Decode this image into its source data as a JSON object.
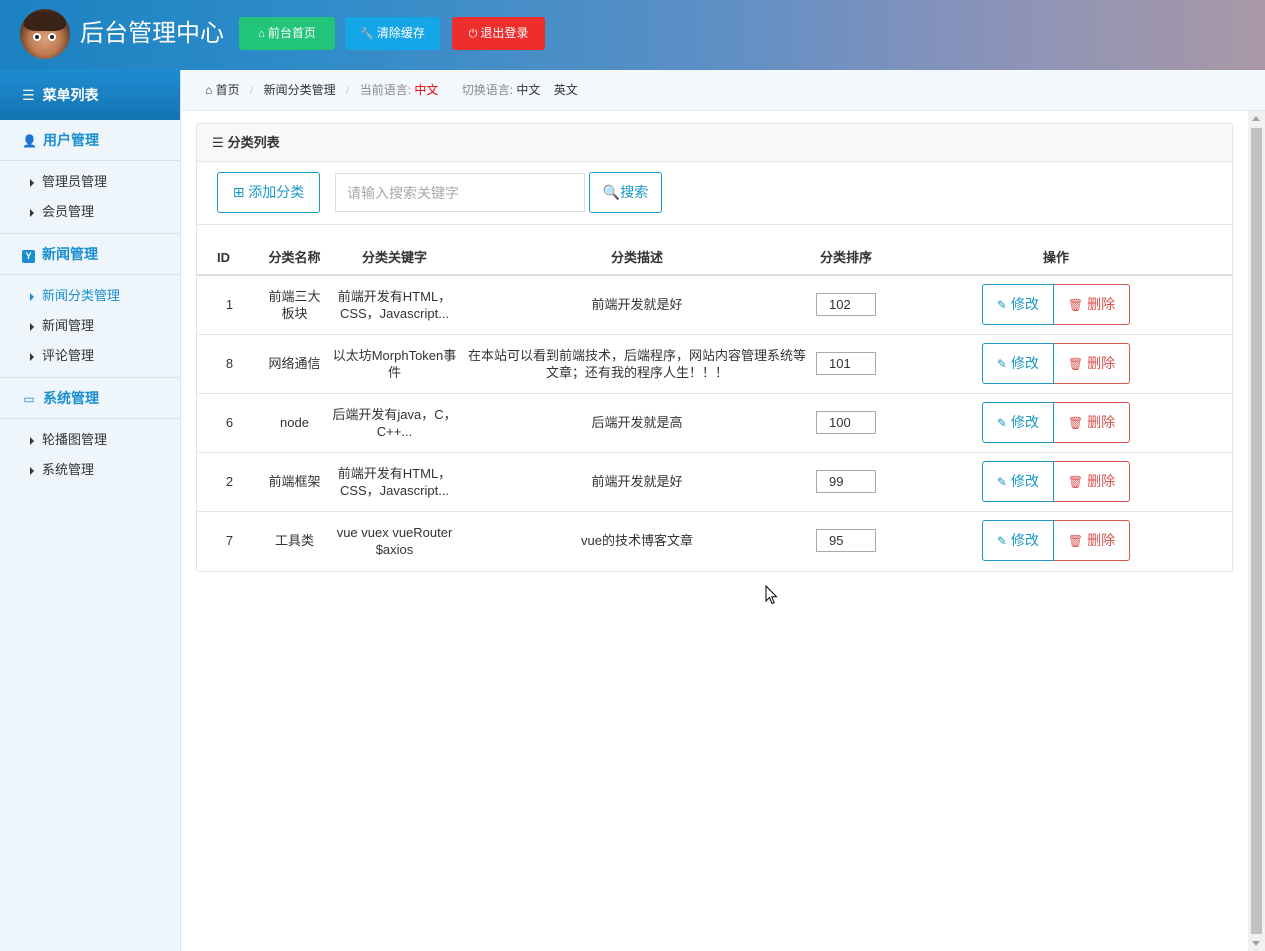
{
  "header": {
    "title": "后台管理中心",
    "buttons": {
      "home": "前台首页",
      "clear_cache": "清除缓存",
      "logout": "退出登录"
    }
  },
  "sidebar": {
    "title": "菜单列表",
    "groups": [
      {
        "label": "用户管理",
        "icon": "user-icon",
        "items": [
          {
            "label": "管理员管理"
          },
          {
            "label": "会员管理"
          }
        ]
      },
      {
        "label": "新闻管理",
        "icon": "y-badge-icon",
        "items": [
          {
            "label": "新闻分类管理",
            "active": true
          },
          {
            "label": "新闻管理"
          },
          {
            "label": "评论管理"
          }
        ]
      },
      {
        "label": "系统管理",
        "icon": "hdd-icon",
        "items": [
          {
            "label": "轮播图管理"
          },
          {
            "label": "系统管理"
          }
        ]
      }
    ]
  },
  "breadcrumb": {
    "home": "首页",
    "current": "新闻分类管理",
    "lang_label": "当前语言:",
    "lang_value": "中文",
    "switch_label": "切换语言:",
    "switch_zh": "中文",
    "switch_en": "英文"
  },
  "panel": {
    "title": "分类列表",
    "add_button": "添加分类",
    "search_placeholder": "请输入搜索关键字",
    "search_button": "搜索"
  },
  "table": {
    "columns": [
      "ID",
      "分类名称",
      "分类关键字",
      "分类描述",
      "分类排序",
      "操作"
    ],
    "edit_label": "修改",
    "delete_label": "删除",
    "rows": [
      {
        "id": "1",
        "name": "前端三大板块",
        "keywords": "前端开发有HTML，CSS，Javascript...",
        "desc": "前端开发就是好",
        "sort": "102"
      },
      {
        "id": "8",
        "name": "网络通信",
        "keywords": "以太坊MorphToken事件",
        "desc": "在本站可以看到前端技术，后端程序，网站内容管理系统等文章；还有我的程序人生！！！",
        "sort": "101"
      },
      {
        "id": "6",
        "name": "node",
        "keywords": "后端开发有java，C，C++...",
        "desc": "后端开发就是高",
        "sort": "100"
      },
      {
        "id": "2",
        "name": "前端框架",
        "keywords": "前端开发有HTML，CSS，Javascript...",
        "desc": "前端开发就是好",
        "sort": "99"
      },
      {
        "id": "7",
        "name": "工具类",
        "keywords": "vue vuex vueRouter $axios",
        "desc": "vue的技术博客文章",
        "sort": "95"
      }
    ]
  },
  "colors": {
    "primary": "#1a98c6",
    "green": "#22c47a",
    "blue": "#15a6e8",
    "red": "#ee2d2d",
    "sidebar_accent": "#1a8fd0"
  }
}
